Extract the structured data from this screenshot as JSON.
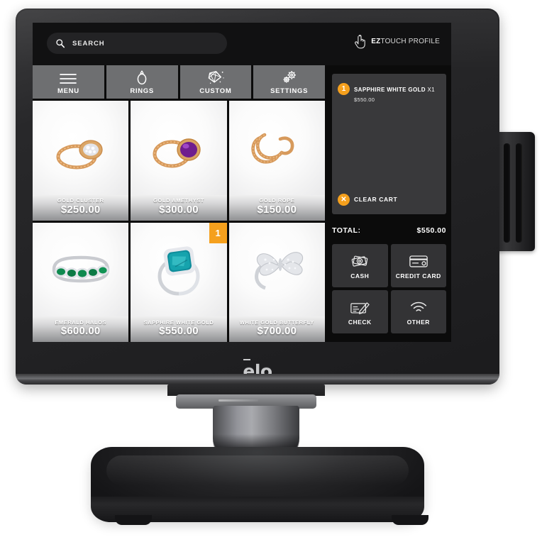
{
  "device": {
    "brand_logo": "elo",
    "peripheral": "magnetic-stripe-reader"
  },
  "screen": {
    "search": {
      "placeholder": "SEARCH",
      "value": "",
      "icon": "search-icon"
    },
    "profile": {
      "prefix": "EZ",
      "suffix": "TOUCH PROFILE",
      "icon": "touch-hand-icon"
    },
    "nav": [
      {
        "label": "MENU",
        "icon": "hamburger-menu-icon"
      },
      {
        "label": "RINGS",
        "icon": "ring-icon"
      },
      {
        "label": "CUSTOM",
        "icon": "gem-icon"
      },
      {
        "label": "SETTINGS",
        "icon": "gears-icon"
      }
    ],
    "products": [
      {
        "name": "GOLD CLUSTER",
        "price": "$250.00",
        "badge": ""
      },
      {
        "name": "GOLD AMETHYST",
        "price": "$300.00",
        "badge": ""
      },
      {
        "name": "GOLD ROPE",
        "price": "$150.00",
        "badge": ""
      },
      {
        "name": "EMERALD HALOS",
        "price": "$600.00",
        "badge": ""
      },
      {
        "name": "SAPPHIRE WHITE GOLD",
        "price": "$550.00",
        "badge": "1"
      },
      {
        "name": "WHITE GOLD BUTTERFLY",
        "price": "$700.00",
        "badge": ""
      }
    ],
    "cart": {
      "items": [
        {
          "qty_badge": "1",
          "name": "SAPPHIRE WHITE GOLD",
          "qty_label": "X1",
          "price": "$550.00"
        }
      ],
      "clear_label": "CLEAR CART",
      "clear_icon": "close-x-icon",
      "total_label": "TOTAL:",
      "total_value": "$550.00"
    },
    "payments": [
      {
        "label": "CASH",
        "icon": "cash-icon"
      },
      {
        "label": "CREDIT CARD",
        "icon": "credit-card-icon"
      },
      {
        "label": "CHECK",
        "icon": "check-writing-icon"
      },
      {
        "label": "OTHER",
        "icon": "contactless-wireless-icon"
      }
    ]
  },
  "colors": {
    "accent_orange": "#f5a01d",
    "nav_gray": "#6e6f71",
    "panel_gray": "#39393b",
    "pay_gray": "#333335",
    "screen_black": "#0b0b0b"
  }
}
